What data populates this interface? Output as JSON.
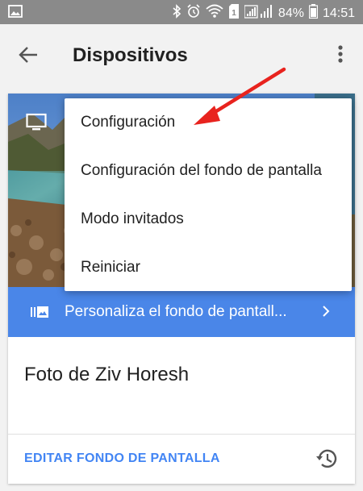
{
  "status_bar": {
    "battery": "84%",
    "time": "14:51",
    "icons": [
      "image-icon",
      "bluetooth-icon",
      "alarm-icon",
      "wifi-icon",
      "sim-icon",
      "signal-icon",
      "battery-icon"
    ]
  },
  "app_bar": {
    "title": "Dispositivos",
    "back_icon": "arrow-back-icon",
    "overflow_icon": "more-vert-icon"
  },
  "device_card": {
    "device_icon": "tv-icon",
    "banner_label": "Personaliza el fondo de pantall...",
    "photo_credit": "Foto de Ziv Horesh",
    "edit_label": "EDITAR FONDO DE PANTALLA",
    "history_icon": "history-icon",
    "banner_color": "#4a86e8",
    "link_color": "#4285f4"
  },
  "menu": {
    "items": [
      {
        "label": "Configuración"
      },
      {
        "label": "Configuración del fondo de pantalla"
      },
      {
        "label": "Modo invitados"
      },
      {
        "label": "Reiniciar"
      }
    ]
  },
  "annotation": {
    "arrow_color": "#e8231e"
  }
}
